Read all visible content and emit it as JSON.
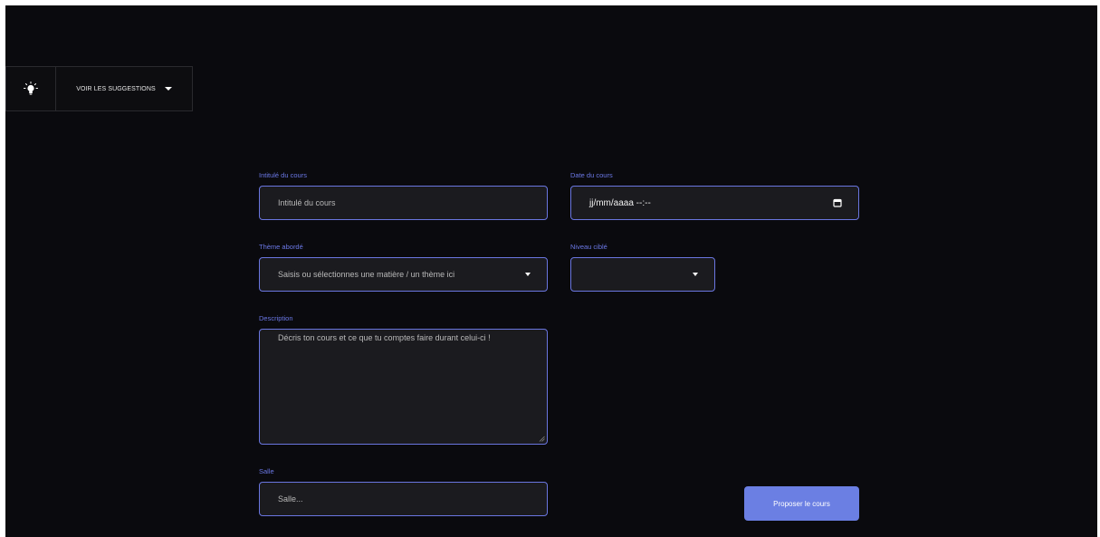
{
  "toolbar": {
    "bulb_icon": "lightbulb-icon",
    "suggestions_label": "VOIR LES SUGGESTIONS",
    "suggestions_caret_icon": "caret-down-icon"
  },
  "form": {
    "title": {
      "label": "Intitulé du cours",
      "placeholder": "Intitulé du cours",
      "value": ""
    },
    "date": {
      "label": "Date du cours",
      "value": "jj/mm/aaaa --:--",
      "icon": "calendar-icon"
    },
    "theme": {
      "label": "Thème abordé",
      "placeholder": "Saisis ou sélectionnes une matière / un thème ici",
      "icon": "caret-down-icon"
    },
    "level": {
      "label": "Niveau ciblé",
      "selected": "",
      "icon": "caret-down-icon"
    },
    "description": {
      "label": "Description",
      "placeholder": "Décris ton cours et ce que tu comptes faire durant celui-ci !",
      "value": ""
    },
    "room": {
      "label": "Salle",
      "placeholder": "Salle...",
      "value": ""
    },
    "submit_label": "Proposer le cours"
  },
  "colors": {
    "background": "#0a0a0e",
    "field_background": "#1b1b1f",
    "accent": "#6a76e0",
    "button": "#6b7fe3"
  }
}
